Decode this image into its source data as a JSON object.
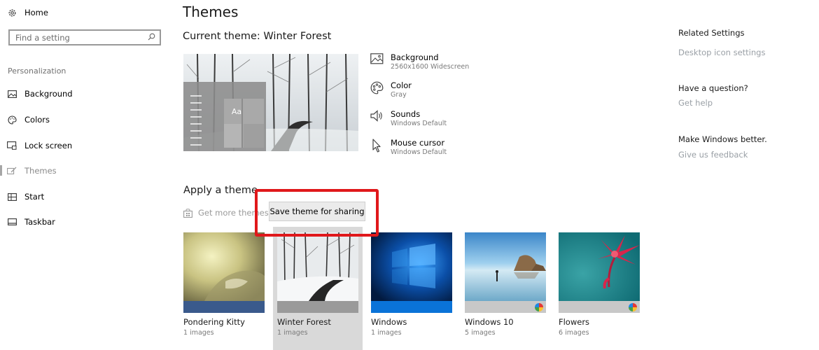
{
  "sidebar": {
    "home_label": "Home",
    "search_placeholder": "Find a setting",
    "section_label": "Personalization",
    "items": [
      {
        "label": "Background",
        "icon": "picture-icon"
      },
      {
        "label": "Colors",
        "icon": "palette-icon"
      },
      {
        "label": "Lock screen",
        "icon": "lock-screen-icon"
      },
      {
        "label": "Themes",
        "icon": "brush-icon",
        "active": true
      },
      {
        "label": "Start",
        "icon": "start-grid-icon"
      },
      {
        "label": "Taskbar",
        "icon": "taskbar-icon"
      }
    ]
  },
  "main": {
    "title": "Themes",
    "current_theme": "Current theme: Winter Forest",
    "preview_sample": "Aa",
    "properties": [
      {
        "name": "Background",
        "value": "2560x1600 Widescreen",
        "icon": "picture-icon"
      },
      {
        "name": "Color",
        "value": "Gray",
        "icon": "palette-icon"
      },
      {
        "name": "Sounds",
        "value": "Windows Default",
        "icon": "speaker-icon"
      },
      {
        "name": "Mouse cursor",
        "value": "Windows Default",
        "icon": "cursor-icon"
      }
    ],
    "apply_heading": "Apply a theme",
    "get_more_link": "Get more themes in",
    "context_menu_item": "Save theme for sharing",
    "themes": [
      {
        "name": "Pondering Kitty",
        "count": "1 images"
      },
      {
        "name": "Winter Forest",
        "count": "1 images",
        "selected": true
      },
      {
        "name": "Windows",
        "count": "1 images"
      },
      {
        "name": "Windows 10",
        "count": "5 images"
      },
      {
        "name": "Flowers",
        "count": "6 images"
      }
    ]
  },
  "related": {
    "title": "Related Settings",
    "desktop_icons": "Desktop icon settings",
    "question_title": "Have a question?",
    "get_help": "Get help",
    "feedback_title": "Make Windows better.",
    "feedback_link": "Give us feedback"
  },
  "colors": {
    "accent_gray": "#a6a6a6",
    "highlight_red": "#e0181b",
    "windows_blue": "#0a73d8",
    "kitty_bar": "#3a5a8c"
  }
}
